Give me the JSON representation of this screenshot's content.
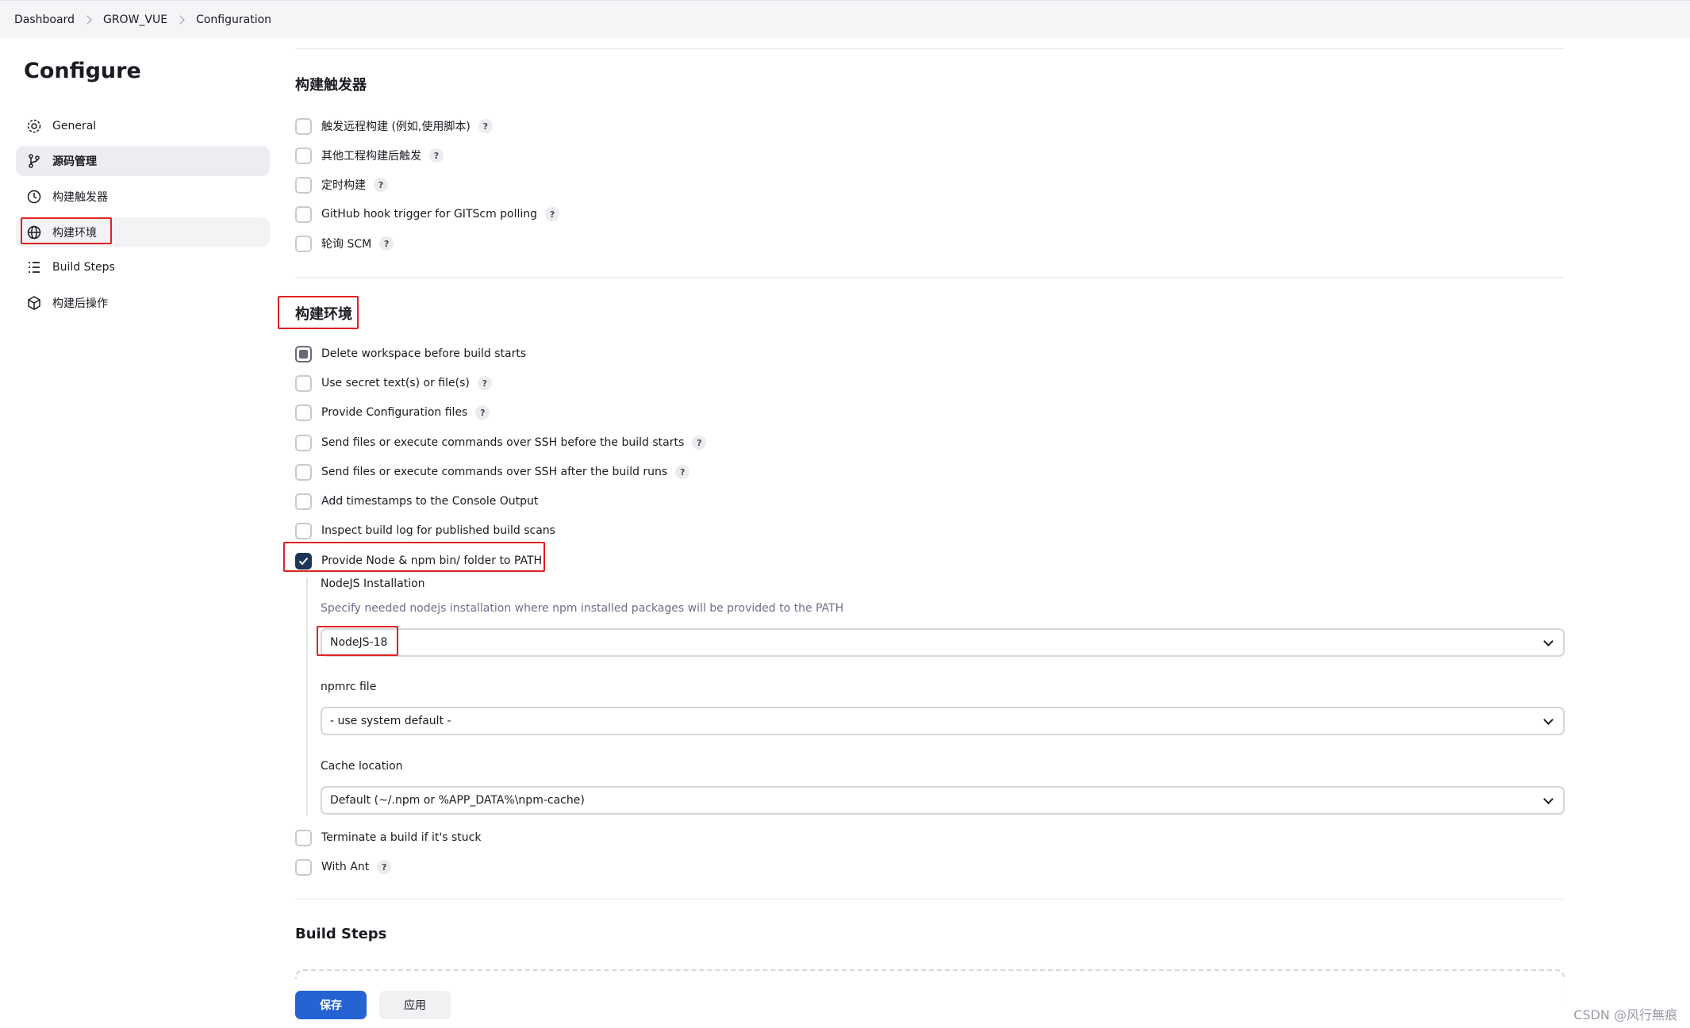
{
  "breadcrumb": [
    "Dashboard",
    "GROW_VUE",
    "Configuration"
  ],
  "page_title": "Configure",
  "sidebar": {
    "items": [
      {
        "label": "General",
        "icon": "gear-icon"
      },
      {
        "label": "源码管理",
        "icon": "branch-icon"
      },
      {
        "label": "构建触发器",
        "icon": "clock-icon"
      },
      {
        "label": "构建环境",
        "icon": "globe-icon"
      },
      {
        "label": "Build Steps",
        "icon": "list-icon"
      },
      {
        "label": "构建后操作",
        "icon": "cube-icon"
      }
    ]
  },
  "triggers": {
    "title": "构建触发器",
    "options": [
      {
        "label": "触发远程构建 (例如,使用脚本)",
        "checked": false,
        "help": "?"
      },
      {
        "label": "其他工程构建后触发",
        "checked": false,
        "help": "?"
      },
      {
        "label": "定时构建",
        "checked": false,
        "help": "?"
      },
      {
        "label": "GitHub hook trigger for GITScm polling",
        "checked": false,
        "help": "?"
      },
      {
        "label": "轮询 SCM",
        "checked": false,
        "help": "?"
      }
    ]
  },
  "environment": {
    "title": "构建环境",
    "options": [
      {
        "label": "Delete workspace before build starts",
        "state": "indeterminate"
      },
      {
        "label": "Use secret text(s) or file(s)",
        "help": "?"
      },
      {
        "label": "Provide Configuration files",
        "help": "?"
      },
      {
        "label": "Send files or execute commands over SSH before the build starts",
        "help": "?"
      },
      {
        "label": "Send files or execute commands over SSH after the build runs",
        "help": "?"
      },
      {
        "label": "Add timestamps to the Console Output"
      },
      {
        "label": "Inspect build log for published build scans"
      },
      {
        "label": "Provide Node & npm bin/ folder to PATH",
        "state": "checked"
      }
    ],
    "nodejs": {
      "label": "NodeJS Installation",
      "description": "Specify needed nodejs installation where npm installed packages will be provided to the PATH",
      "value": "NodeJS-18"
    },
    "npmrc": {
      "label": "npmrc file",
      "value": "- use system default -"
    },
    "cache": {
      "label": "Cache location",
      "value": "Default (~/.npm or %APP_DATA%\\npm-cache)"
    },
    "more_options": [
      {
        "label": "Terminate a build if it's stuck"
      },
      {
        "label": "With Ant",
        "help": "?"
      }
    ]
  },
  "build_steps": {
    "title": "Build Steps"
  },
  "buttons": {
    "save": "保存",
    "apply": "应用"
  },
  "watermark": "CSDN @风行無痕",
  "colors": {
    "highlight": "#e02020",
    "primary": "#2463d1",
    "checked": "#1d3557"
  }
}
